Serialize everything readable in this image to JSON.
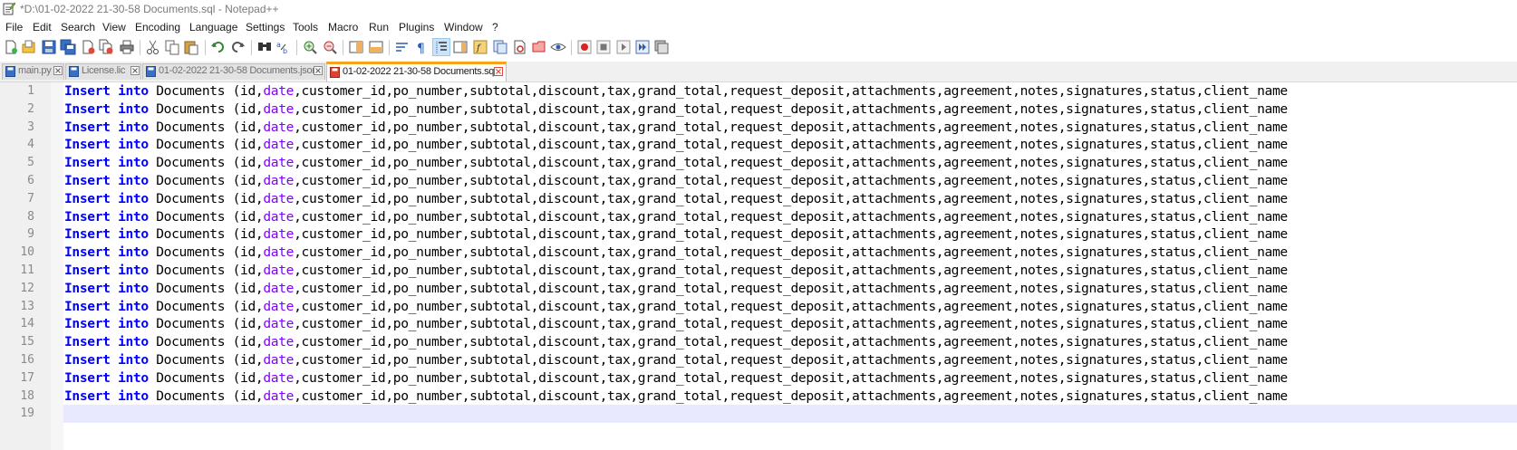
{
  "window": {
    "title": "*D:\\01-02-2022 21-30-58 Documents.sql - Notepad++"
  },
  "menu": [
    "File",
    "Edit",
    "Search",
    "View",
    "Encoding",
    "Language",
    "Settings",
    "Tools",
    "Macro",
    "Run",
    "Plugins",
    "Window",
    "?"
  ],
  "toolbar": {
    "buttons": [
      "new-file",
      "open-file",
      "save",
      "save-all",
      "close",
      "close-all",
      "print",
      "cut",
      "copy",
      "paste",
      "undo",
      "redo",
      "find",
      "replace",
      "zoom-in",
      "zoom-out",
      "sync-vertical",
      "sync-horizontal",
      "word-wrap",
      "show-all-characters",
      "indent-guide",
      "document-map",
      "function-list",
      "folder-as-workspace",
      "monitoring",
      "record-macro",
      "stop-recording",
      "playback-macro",
      "run-macro-multiple",
      "save-macro"
    ],
    "active": "indent-guide"
  },
  "tabs": [
    {
      "label": "main.py",
      "active": false
    },
    {
      "label": "License.lic",
      "active": false
    },
    {
      "label": "01-02-2022 21-30-58 Documents.json",
      "active": false
    },
    {
      "label": "01-02-2022 21-30-58 Documents.sql",
      "active": true,
      "modified": true
    }
  ],
  "editor": {
    "line_numbers": [
      "1",
      "2",
      "3",
      "4",
      "5",
      "6",
      "7",
      "8",
      "9",
      "10",
      "11",
      "12",
      "13",
      "14",
      "15",
      "16",
      "17",
      "18",
      "19"
    ],
    "current_line": "19",
    "code": {
      "kw_insert": "Insert",
      "kw_into": "into",
      "table": "Documents",
      "open": "(id,",
      "fn_date": "date",
      "rest": ",customer_id,po_number,subtotal,discount,tax,grand_total,request_deposit,attachments,agreement,notes,signatures,status,client_name"
    }
  },
  "colors": {
    "keyword": "#0000ff",
    "function": "#8000ff",
    "active_tab_accent": "#f7a21b",
    "current_line": "#e8e8ff"
  }
}
